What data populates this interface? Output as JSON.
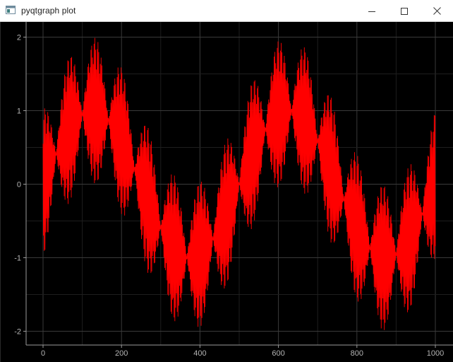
{
  "window": {
    "title": "pyqtgraph plot",
    "controls": [
      "minimize-icon",
      "maximize-icon",
      "close-icon"
    ]
  },
  "colors": {
    "background": "#000000",
    "curve": "#ff0000",
    "grid": "#3a3a3a",
    "axis": "#9a9a9a",
    "tick_text": "#b4b4b4"
  },
  "chart_data": {
    "type": "line",
    "title": "",
    "xlabel": "",
    "ylabel": "",
    "xlim": [
      -40,
      1010
    ],
    "ylim": [
      -2.1,
      2.1
    ],
    "x_ticks": [
      0,
      200,
      400,
      600,
      800,
      1000
    ],
    "y_ticks": [
      -2,
      -1,
      0,
      1,
      2
    ],
    "grid": true,
    "series": [
      {
        "x_range": [
          0,
          1000
        ],
        "description_points": 1000,
        "slow_sine_period": 500,
        "slow_sine_amplitude": 1,
        "fast_oscillation_amplitude": 1
      }
    ]
  }
}
